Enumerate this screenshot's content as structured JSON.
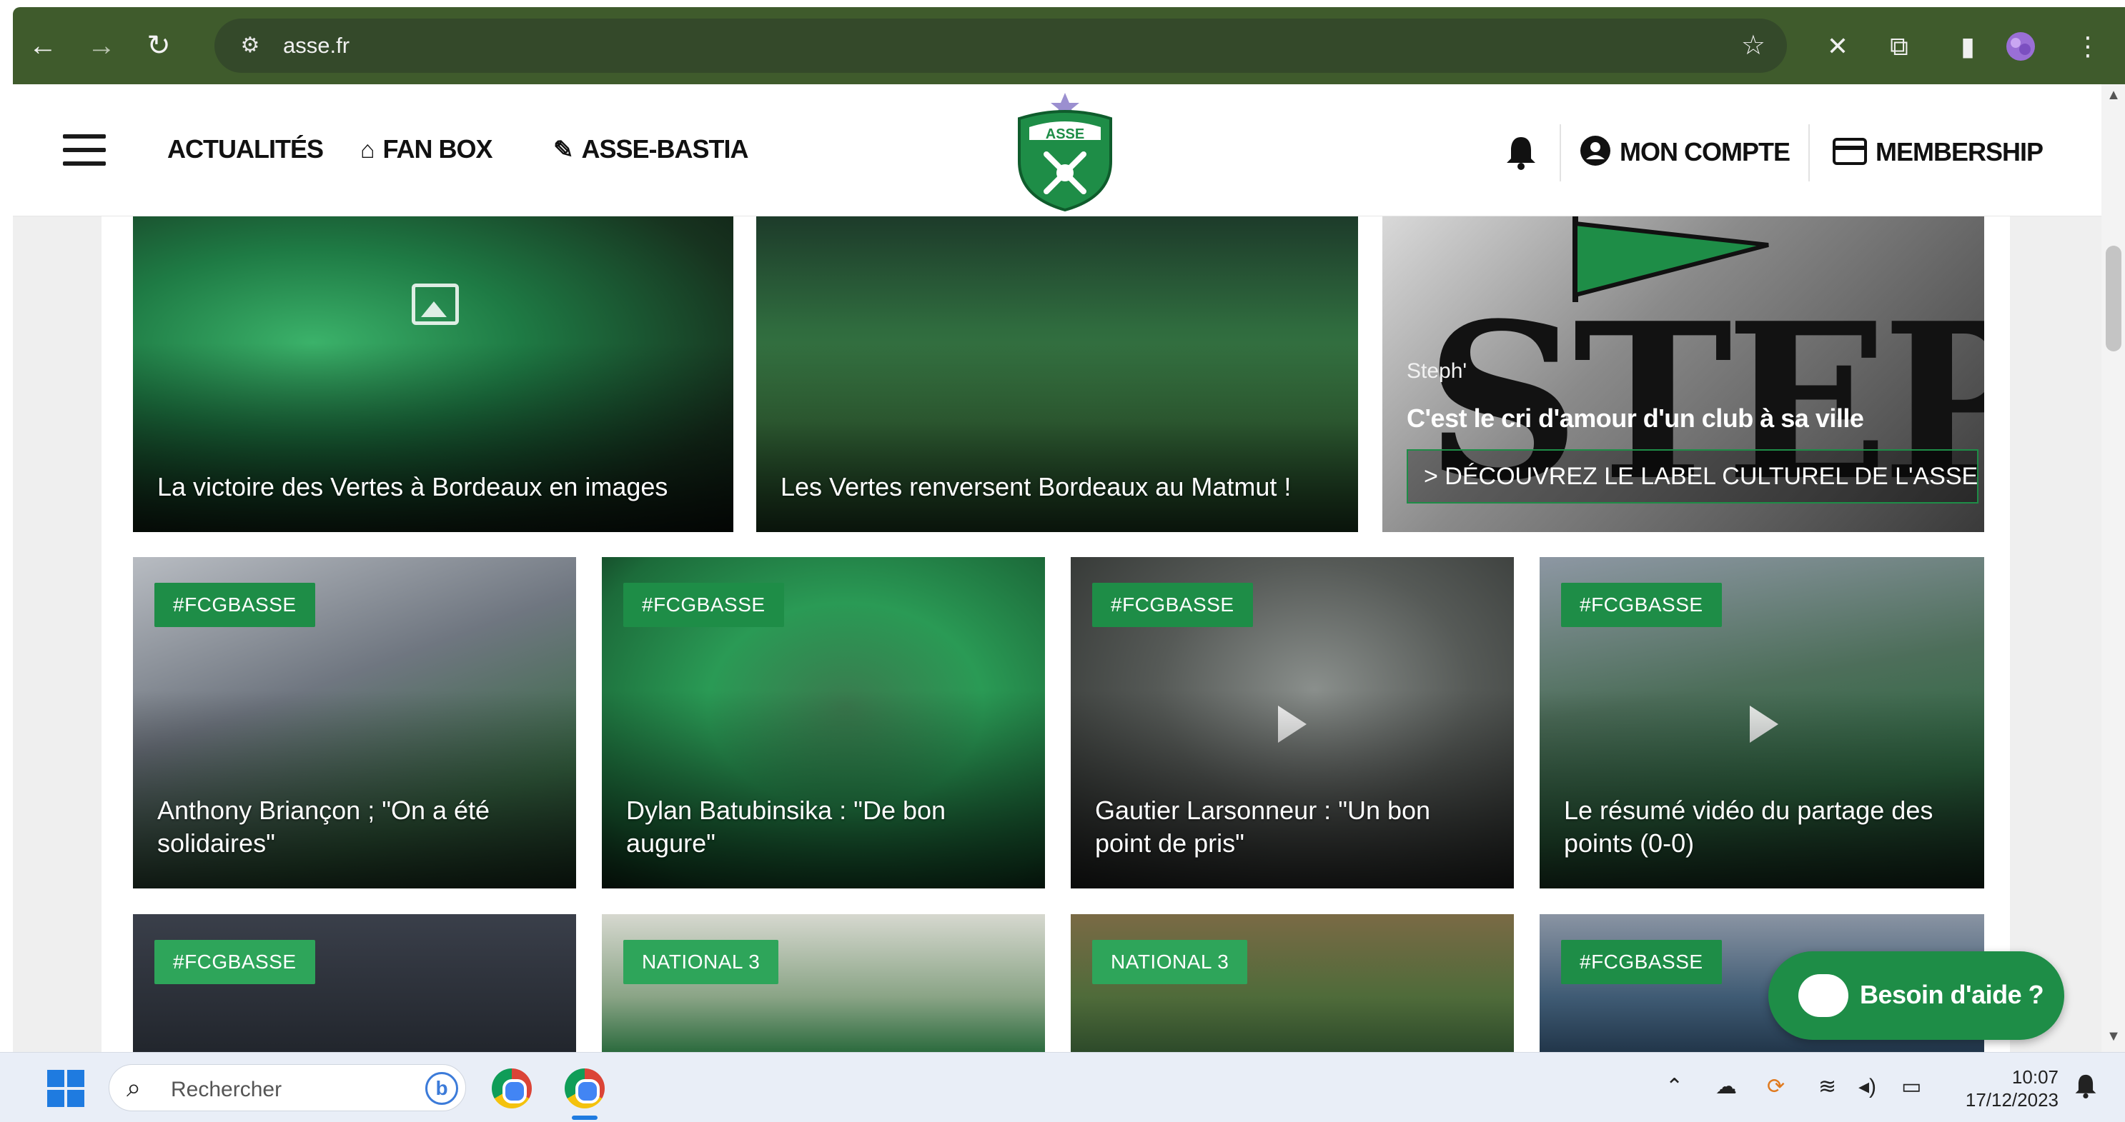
{
  "browser": {
    "url": "asse.fr",
    "back_icon": "arrow-left-icon",
    "forward_icon": "arrow-right-icon",
    "reload_icon": "reload-icon",
    "site_info_icon": "tune-icon",
    "bookmark_icon": "star-icon",
    "extensions": [
      "x-extension-icon",
      "puzzle-icon",
      "sidepanel-icon",
      "profile-avatar-icon",
      "kebab-menu-icon"
    ]
  },
  "header": {
    "menu_icon": "hamburger-icon",
    "links": [
      {
        "label": "ACTUALITÉS",
        "icon": ""
      },
      {
        "label": "FAN BOX",
        "icon": "home-icon"
      },
      {
        "label": "ASSE-BASTIA",
        "icon": "ticket-icon"
      }
    ],
    "logo_text": "ASSE",
    "account_label": "MON COMPTE",
    "membership_label": "MEMBERSHIP",
    "colors": {
      "brand_green": "#1e8d47",
      "chrome_green": "#3f5b2c"
    }
  },
  "row1": [
    {
      "title": "La victoire des Vertes à Bordeaux en images",
      "media": "gallery"
    },
    {
      "title": "Les Vertes renversent Bordeaux au Matmut !",
      "media": "none"
    },
    {
      "steph_word": "STEPH'",
      "small": "Steph'",
      "title": "C'est le cri d'amour d'un club à sa ville",
      "cta": "> DÉCOUVREZ LE LABEL CULTUREL DE L'ASSE"
    }
  ],
  "row2": [
    {
      "tag": "#FCGBASSE",
      "title": "Anthony Briançon ; \"On a été solidaires\"",
      "media": "none"
    },
    {
      "tag": "#FCGBASSE",
      "title": "Dylan Batubinsika : \"De bon augure\"",
      "media": "none"
    },
    {
      "tag": "#FCGBASSE",
      "title": "Gautier Larsonneur : \"Un bon point de pris\"",
      "media": "video"
    },
    {
      "tag": "#FCGBASSE",
      "title": "Le résumé vidéo du partage des points (0-0)",
      "media": "video"
    }
  ],
  "row3": [
    {
      "tag": "#FCGBASSE"
    },
    {
      "tag": "NATIONAL 3"
    },
    {
      "tag": "NATIONAL 3"
    },
    {
      "tag": "#FCGBASSE"
    }
  ],
  "help": {
    "label": "Besoin d'aide ?",
    "icon": "chat-bubble-icon"
  },
  "taskbar": {
    "search_placeholder": "Rechercher",
    "search_icon": "search-icon",
    "time": "10:07",
    "date": "17/12/2023",
    "tray_icons": [
      "chevron-up-icon",
      "cloud-icon",
      "sync-icon",
      "wifi-icon",
      "volume-icon",
      "battery-icon",
      "notification-bell-icon"
    ]
  }
}
